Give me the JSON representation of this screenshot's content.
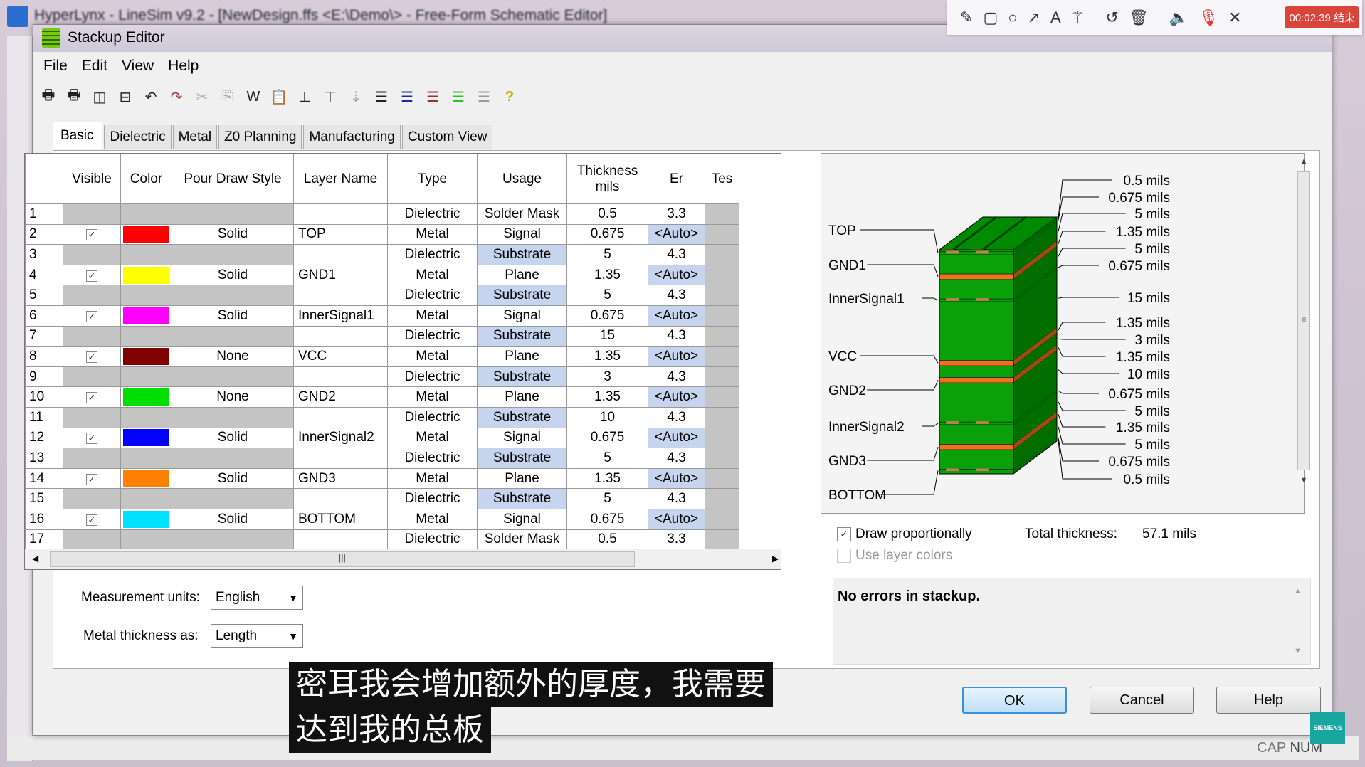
{
  "background": {
    "app_title": "HyperLynx - LineSim v9.2 - [NewDesign.ffs <E:\\Demo\\> - Free-Form Schematic Editor]",
    "status": {
      "cap": "CAP",
      "num": "NUM"
    }
  },
  "window": {
    "title": "Stackup Editor"
  },
  "menu": [
    "File",
    "Edit",
    "View",
    "Help"
  ],
  "toolbar": [
    {
      "icon": "print-icon",
      "glyph": "🖶"
    },
    {
      "icon": "print-color-icon",
      "glyph": "🖶"
    },
    {
      "icon": "split-vertical-icon",
      "glyph": "◫"
    },
    {
      "icon": "split-horizontal-icon",
      "glyph": "⊟"
    },
    {
      "icon": "undo-icon",
      "glyph": "↶"
    },
    {
      "icon": "redo-icon",
      "glyph": "↷",
      "disabled": true
    },
    {
      "icon": "cut-icon",
      "glyph": "✂",
      "disabled": true
    },
    {
      "icon": "copy-icon",
      "glyph": "⎘",
      "disabled": true
    },
    {
      "icon": "word-export-icon",
      "glyph": "W"
    },
    {
      "icon": "paste-icon",
      "glyph": "📋",
      "disabled": true
    },
    {
      "icon": "insert-above-icon",
      "glyph": "⊥"
    },
    {
      "icon": "insert-below-icon",
      "glyph": "⊤"
    },
    {
      "icon": "sort-icon",
      "glyph": "⇣",
      "disabled": true
    },
    {
      "icon": "lock-layers-icon",
      "glyph": "☰"
    },
    {
      "icon": "layers-blue-icon",
      "glyph": "☰"
    },
    {
      "icon": "layers-red-icon",
      "glyph": "☰"
    },
    {
      "icon": "layers-green-icon",
      "glyph": "☰"
    },
    {
      "icon": "layers-gray-icon",
      "glyph": "☰"
    },
    {
      "icon": "help-icon",
      "glyph": "?"
    }
  ],
  "tabs": [
    {
      "label": "Basic",
      "active": true
    },
    {
      "label": "Dielectric"
    },
    {
      "label": "Metal"
    },
    {
      "label": "Z0 Planning"
    },
    {
      "label": "Manufacturing"
    },
    {
      "label": "Custom View"
    }
  ],
  "grid": {
    "columns": [
      "",
      "Visible",
      "Color",
      "Pour Draw Style",
      "Layer Name",
      "Type",
      "Usage",
      "Thickness\nmils",
      "Er",
      "Tes"
    ],
    "rows": [
      {
        "n": "1",
        "vis": null,
        "color": null,
        "pour": "",
        "name": "",
        "type": "Dielectric",
        "usage": "Solder Mask",
        "th": "0.5",
        "er": "3.3"
      },
      {
        "n": "2",
        "vis": true,
        "color": "#ff0000",
        "pour": "Solid",
        "name": "TOP",
        "type": "Metal",
        "usage": "Signal",
        "th": "0.675",
        "er": "<Auto>"
      },
      {
        "n": "3",
        "vis": null,
        "color": null,
        "pour": "",
        "name": "",
        "type": "Dielectric",
        "usage": "Substrate",
        "th": "5",
        "er": "4.3"
      },
      {
        "n": "4",
        "vis": true,
        "color": "#ffff00",
        "pour": "Solid",
        "name": "GND1",
        "type": "Metal",
        "usage": "Plane",
        "th": "1.35",
        "er": "<Auto>"
      },
      {
        "n": "5",
        "vis": null,
        "color": null,
        "pour": "",
        "name": "",
        "type": "Dielectric",
        "usage": "Substrate",
        "th": "5",
        "er": "4.3"
      },
      {
        "n": "6",
        "vis": true,
        "color": "#ff00ff",
        "pour": "Solid",
        "name": "InnerSignal1",
        "type": "Metal",
        "usage": "Signal",
        "th": "0.675",
        "er": "<Auto>"
      },
      {
        "n": "7",
        "vis": null,
        "color": null,
        "pour": "",
        "name": "",
        "type": "Dielectric",
        "usage": "Substrate",
        "th": "15",
        "er": "4.3"
      },
      {
        "n": "8",
        "vis": true,
        "color": "#800000",
        "pour": "None",
        "name": "VCC",
        "type": "Metal",
        "usage": "Plane",
        "th": "1.35",
        "er": "<Auto>"
      },
      {
        "n": "9",
        "vis": null,
        "color": null,
        "pour": "",
        "name": "",
        "type": "Dielectric",
        "usage": "Substrate",
        "th": "3",
        "er": "4.3"
      },
      {
        "n": "10",
        "vis": true,
        "color": "#00dd00",
        "pour": "None",
        "name": "GND2",
        "type": "Metal",
        "usage": "Plane",
        "th": "1.35",
        "er": "<Auto>"
      },
      {
        "n": "11",
        "vis": null,
        "color": null,
        "pour": "",
        "name": "",
        "type": "Dielectric",
        "usage": "Substrate",
        "th": "10",
        "er": "4.3"
      },
      {
        "n": "12",
        "vis": true,
        "color": "#0000ff",
        "pour": "Solid",
        "name": "InnerSignal2",
        "type": "Metal",
        "usage": "Signal",
        "th": "0.675",
        "er": "<Auto>"
      },
      {
        "n": "13",
        "vis": null,
        "color": null,
        "pour": "",
        "name": "",
        "type": "Dielectric",
        "usage": "Substrate",
        "th": "5",
        "er": "4.3"
      },
      {
        "n": "14",
        "vis": true,
        "color": "#ff8000",
        "pour": "Solid",
        "name": "GND3",
        "type": "Metal",
        "usage": "Plane",
        "th": "1.35",
        "er": "<Auto>"
      },
      {
        "n": "15",
        "vis": null,
        "color": null,
        "pour": "",
        "name": "",
        "type": "Dielectric",
        "usage": "Substrate",
        "th": "5",
        "er": "4.3"
      },
      {
        "n": "16",
        "vis": true,
        "color": "#00e0ff",
        "pour": "Solid",
        "name": "BOTTOM",
        "type": "Metal",
        "usage": "Signal",
        "th": "0.675",
        "er": "<Auto>"
      },
      {
        "n": "17",
        "vis": null,
        "color": null,
        "pour": "",
        "name": "",
        "type": "Dielectric",
        "usage": "Solder Mask",
        "th": "0.5",
        "er": "3.3"
      }
    ]
  },
  "settings": {
    "units_label": "Measurement units:",
    "units_value": "English",
    "metal_label": "Metal thickness as:",
    "metal_value": "Length"
  },
  "diagram": {
    "layer_labels": [
      "TOP",
      "GND1",
      "InnerSignal1",
      "VCC",
      "GND2",
      "InnerSignal2",
      "GND3",
      "BOTTOM"
    ],
    "thickness_labels": [
      "0.5 mils",
      "0.675 mils",
      "5 mils",
      "1.35 mils",
      "5 mils",
      "0.675 mils",
      "15 mils",
      "1.35 mils",
      "3 mils",
      "1.35 mils",
      "10 mils",
      "0.675 mils",
      "5 mils",
      "1.35 mils",
      "5 mils",
      "0.675 mils",
      "0.5 mils"
    ],
    "colors": {
      "dielectric": "#0aa00a",
      "dielectric_side": "#006e00",
      "top": "#008a00",
      "plane": "#f07020",
      "plane_side": "#a04a10",
      "trace": "#c08050"
    }
  },
  "options": {
    "draw_proportionally": {
      "label": "Draw proportionally",
      "checked": true
    },
    "use_layer_colors": {
      "label": "Use layer colors",
      "checked": false,
      "disabled": true
    },
    "total_label": "Total thickness:",
    "total_value": "57.1 mils"
  },
  "errors": "No errors in stackup.",
  "buttons": {
    "ok": "OK",
    "cancel": "Cancel",
    "help": "Help"
  },
  "subtitle": [
    "密耳我会增加额外的厚度，我需要",
    "达到我的总板"
  ],
  "recorder": {
    "timer": "00:02:39 结束",
    "tools": [
      "pencil-icon",
      "rectangle-icon",
      "circle-icon",
      "arrow-icon",
      "text-icon",
      "magic-wand-icon",
      "undo-icon",
      "trash-icon",
      "speaker-icon",
      "mic-muted-icon",
      "close-icon"
    ]
  },
  "badge": "SIEMENS"
}
